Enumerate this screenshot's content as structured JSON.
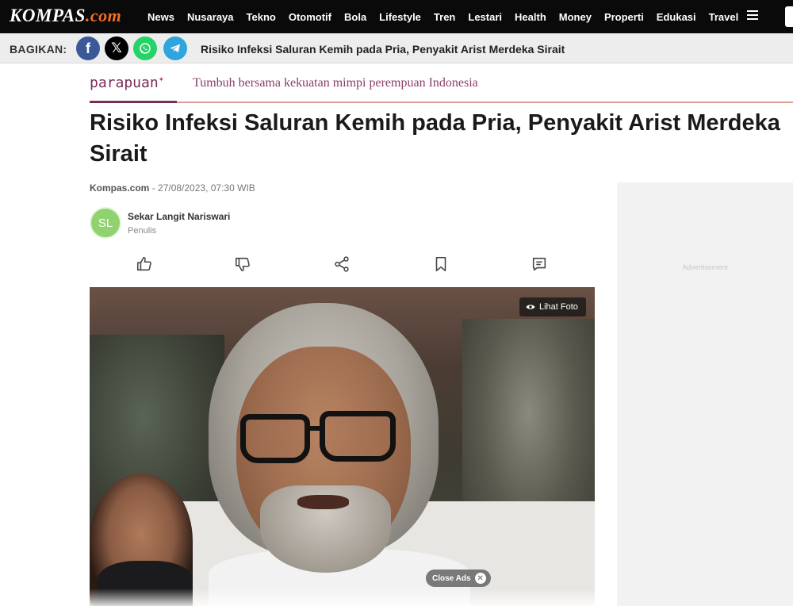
{
  "nav": {
    "logo_main": "KOMPAS",
    "logo_suffix": ".com",
    "items": [
      "News",
      "Nusaraya",
      "Tekno",
      "Otomotif",
      "Bola",
      "Lifestyle",
      "Tren",
      "Lestari",
      "Health",
      "Money",
      "Properti",
      "Edukasi",
      "Travel"
    ],
    "menu_icon": "hamburger-icon"
  },
  "share": {
    "label": "BAGIKAN:",
    "title": "Risiko Infeksi Saluran Kemih pada Pria, Penyakit Arist Merdeka Sirait",
    "facebook": "f",
    "x": "𝕏",
    "colors": {
      "facebook": "#3b5998",
      "x": "#000000",
      "whatsapp": "#25d366",
      "telegram": "#2ea6dd"
    }
  },
  "parapuan": {
    "logo": "parapuan",
    "star": "✦",
    "tagline": "Tumbuh bersama kekuatan mimpi perempuan Indonesia"
  },
  "article": {
    "headline": "Risiko Infeksi Saluran Kemih pada Pria, Penyakit Arist Merdeka Sirait",
    "source": "Kompas.com",
    "date": " - 27/08/2023, 07:30 WIB",
    "author_initials": "SL",
    "author_name": "Sekar Langit Nariswari",
    "author_role": "Penulis",
    "actions": [
      "like-icon",
      "dislike-icon",
      "share-icon",
      "bookmark-icon",
      "comment-icon"
    ],
    "photo_button": "Lihat Foto",
    "close_ads": "Close Ads",
    "close_ads_x": "✕"
  },
  "ad": {
    "label": "Advertisement"
  },
  "colors": {
    "nav_bg": "#0a0a0a",
    "logo_accent": "#f36f21",
    "parapuan": "#7a2b58"
  }
}
